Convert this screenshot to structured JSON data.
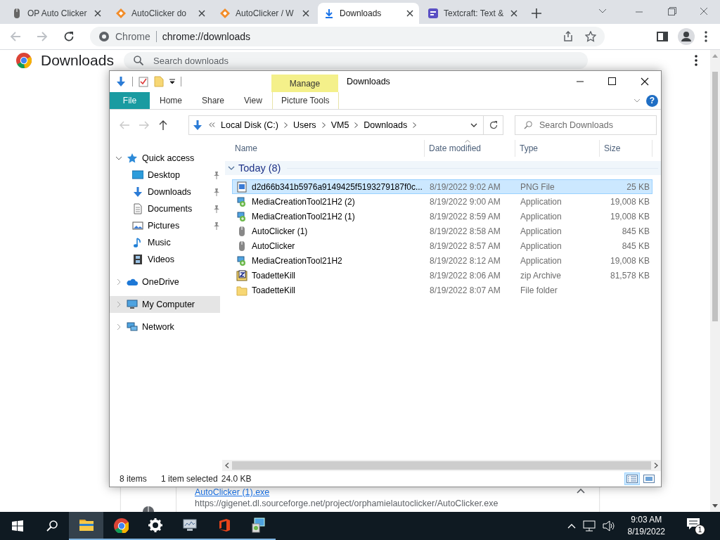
{
  "browser": {
    "tabs": [
      {
        "title": "OP Auto Clicker",
        "kind": "mouse",
        "selected": false
      },
      {
        "title": "AutoClicker do",
        "kind": "diamond",
        "selected": false
      },
      {
        "title": "AutoClicker / W",
        "kind": "diamond",
        "selected": false
      },
      {
        "title": "Downloads",
        "kind": "download",
        "selected": true
      },
      {
        "title": "Textcraft: Text &",
        "kind": "textcraft",
        "selected": false
      }
    ],
    "address": {
      "site_label": "Chrome",
      "url": "chrome://downloads"
    }
  },
  "downloads_page": {
    "title": "Downloads",
    "search": {
      "placeholder": "Search downloads"
    },
    "download": {
      "file": "AutoClicker (1).exe",
      "url": "https://gigenet.dl.sourceforge.net/project/orphamielautoclicker/AutoClicker.exe"
    }
  },
  "explorer": {
    "title": "Downloads",
    "context_tab": "Manage",
    "ribbon_tabs": [
      {
        "label": "File",
        "kind": "backstage"
      },
      {
        "label": "Home",
        "kind": "tab"
      },
      {
        "label": "Share",
        "kind": "tab"
      },
      {
        "label": "View",
        "kind": "tab"
      },
      {
        "label": "Picture Tools",
        "kind": "context"
      }
    ],
    "help": "?",
    "breadcrumb": [
      "Local Disk (C:)",
      "Users",
      "VM5",
      "Downloads"
    ],
    "search": {
      "placeholder": "Search Downloads"
    },
    "nav": [
      {
        "label": "Quick access",
        "kind": "star",
        "expanded": true,
        "selected": false,
        "children": [
          {
            "label": "Desktop",
            "kind": "desktop",
            "pinned": true,
            "selected": false
          },
          {
            "label": "Downloads",
            "kind": "download",
            "pinned": true,
            "selected": false
          },
          {
            "label": "Documents",
            "kind": "document",
            "pinned": true,
            "selected": false
          },
          {
            "label": "Pictures",
            "kind": "pictures",
            "pinned": true,
            "selected": false
          },
          {
            "label": "Music",
            "kind": "music",
            "pinned": false,
            "selected": false
          },
          {
            "label": "Videos",
            "kind": "videos",
            "pinned": false,
            "selected": false
          }
        ]
      },
      {
        "label": "OneDrive",
        "kind": "cloud",
        "expanded": false,
        "selected": false
      },
      {
        "label": "My Computer",
        "kind": "computer",
        "expanded": false,
        "selected": true
      },
      {
        "label": "Network",
        "kind": "network",
        "expanded": false,
        "selected": false
      }
    ],
    "columns": [
      "Name",
      "Date modified",
      "Type",
      "Size"
    ],
    "group": {
      "label": "Today (8)",
      "expanded": true
    },
    "files": [
      {
        "name": "d2d66b341b5976a9149425f5193279187f0c...",
        "date": "8/19/2022 9:02 AM",
        "type": "PNG File",
        "size": "25 KB",
        "kind": "image",
        "selected": true
      },
      {
        "name": "MediaCreationTool21H2 (2)",
        "date": "8/19/2022 9:00 AM",
        "type": "Application",
        "size": "19,008 KB",
        "kind": "installer",
        "selected": false
      },
      {
        "name": "MediaCreationTool21H2 (1)",
        "date": "8/19/2022 8:59 AM",
        "type": "Application",
        "size": "19,008 KB",
        "kind": "installer",
        "selected": false
      },
      {
        "name": "AutoClicker (1)",
        "date": "8/19/2022 8:58 AM",
        "type": "Application",
        "size": "845 KB",
        "kind": "mouse",
        "selected": false
      },
      {
        "name": "AutoClicker",
        "date": "8/19/2022 8:57 AM",
        "type": "Application",
        "size": "845 KB",
        "kind": "mouse",
        "selected": false
      },
      {
        "name": "MediaCreationTool21H2",
        "date": "8/19/2022 8:12 AM",
        "type": "Application",
        "size": "19,008 KB",
        "kind": "installer",
        "selected": false
      },
      {
        "name": "ToadetteKill",
        "date": "8/19/2022 8:06 AM",
        "type": "zip Archive",
        "size": "81,578 KB",
        "kind": "zip",
        "selected": false
      },
      {
        "name": "ToadetteKill",
        "date": "8/19/2022 8:07 AM",
        "type": "File folder",
        "kind": "folder",
        "selected": false
      }
    ],
    "status": {
      "items": "8 items",
      "selection": "1 item selected",
      "size": "24.0 KB"
    },
    "views": [
      {
        "kind": "details",
        "selected": true
      },
      {
        "kind": "large-icons",
        "selected": false
      }
    ]
  },
  "taskbar": {
    "apps": [
      {
        "kind": "explorer",
        "selected": true,
        "running": true
      },
      {
        "kind": "chrome",
        "selected": false,
        "running": true
      },
      {
        "kind": "settings",
        "selected": false,
        "running": true
      },
      {
        "kind": "monitor",
        "selected": false,
        "running": true
      },
      {
        "kind": "office",
        "selected": false,
        "running": true
      },
      {
        "kind": "installer",
        "selected": false,
        "running": true
      }
    ],
    "time": "9:03 AM",
    "date": "8/19/2022",
    "notifications": "1"
  }
}
